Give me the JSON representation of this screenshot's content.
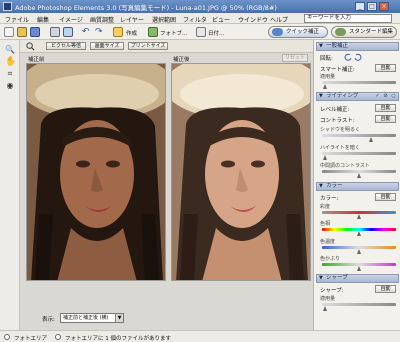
{
  "titlebar": {
    "title": "Adobe Photoshop Elements 3.0 (写真編集モード) - Luna-a01.JPG @ 50% (RGB/8#)",
    "min": "_",
    "max": "□",
    "close": "×"
  },
  "menubar": {
    "items": [
      "ファイル",
      "編集",
      "イメージ",
      "画質調整",
      "レイヤー",
      "選択範囲",
      "フィルタ",
      "ビュー",
      "ウインドウ",
      "ヘルプ"
    ],
    "search_placeholder": "キーワードを入力"
  },
  "toolbar": {
    "create_label": "作成",
    "photo_label": "フォトブ…",
    "date_label": "日付…",
    "quick_fix_label": "クイック補正",
    "standard_edit_label": "スタンダード編集"
  },
  "options_bar": {
    "pixel_label": "ピクセル等倍",
    "fit_label": "画面サイズ",
    "print_label": "プリントサイズ"
  },
  "canvas": {
    "before_label": "補正前",
    "after_label": "補正後",
    "reset_label": "リセット",
    "view_label": "表示:",
    "view_value": "補正前と補正後 (横)"
  },
  "status": {
    "photobin_label": "フォトエリア",
    "info_text": "フォトエリアに 1 個のファイルがあります"
  },
  "panel": {
    "general": {
      "title": "一般補正",
      "rotate_label": "回転:",
      "smart_fix_label": "スマート補正:",
      "auto_label": "自動",
      "amount_label": "適用量"
    },
    "lighting": {
      "title": "ライティング",
      "levels_label": "レベル補正:",
      "contrast_label": "コントラスト:",
      "auto_label": "自動",
      "shadows_label": "シャドウを明るく",
      "highlights_label": "ハイライトを暗く",
      "midtone_label": "中間調のコントラスト"
    },
    "color": {
      "title": "カラー",
      "color_label": "カラー:",
      "auto_label": "自動",
      "hue_label": "彩度",
      "saturation_label": "色相",
      "temperature_label": "色温度",
      "tint_label": "色かぶり"
    },
    "sharpen": {
      "title": "シャープ",
      "sharpen_label": "シャープ:",
      "auto_label": "自動",
      "amount_label": "適用量"
    }
  },
  "colors": {
    "titlebar": "#5a80b8",
    "panel_header": "#b5c1d8",
    "canvas_bg": "#d9d8d2"
  }
}
